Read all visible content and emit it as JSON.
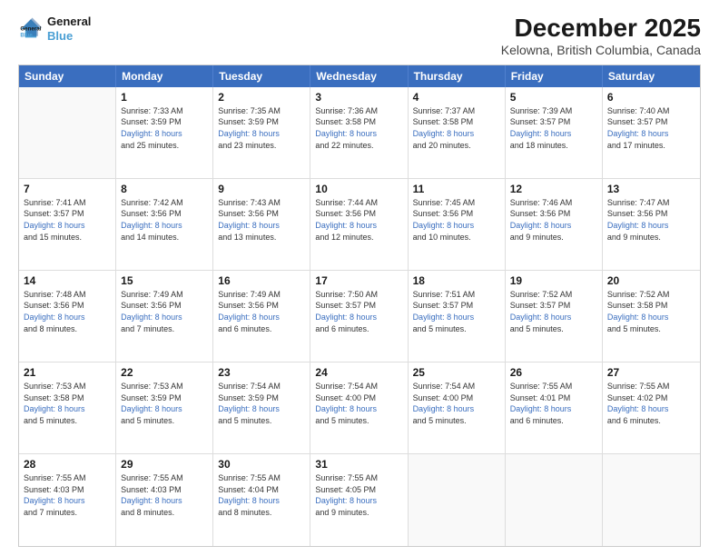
{
  "logo": {
    "line1": "General",
    "line2": "Blue"
  },
  "title": "December 2025",
  "subtitle": "Kelowna, British Columbia, Canada",
  "header_days": [
    "Sunday",
    "Monday",
    "Tuesday",
    "Wednesday",
    "Thursday",
    "Friday",
    "Saturday"
  ],
  "weeks": [
    [
      {
        "day": "",
        "info": []
      },
      {
        "day": "1",
        "info": [
          "Sunrise: 7:33 AM",
          "Sunset: 3:59 PM",
          "Daylight: 8 hours",
          "and 25 minutes."
        ]
      },
      {
        "day": "2",
        "info": [
          "Sunrise: 7:35 AM",
          "Sunset: 3:59 PM",
          "Daylight: 8 hours",
          "and 23 minutes."
        ]
      },
      {
        "day": "3",
        "info": [
          "Sunrise: 7:36 AM",
          "Sunset: 3:58 PM",
          "Daylight: 8 hours",
          "and 22 minutes."
        ]
      },
      {
        "day": "4",
        "info": [
          "Sunrise: 7:37 AM",
          "Sunset: 3:58 PM",
          "Daylight: 8 hours",
          "and 20 minutes."
        ]
      },
      {
        "day": "5",
        "info": [
          "Sunrise: 7:39 AM",
          "Sunset: 3:57 PM",
          "Daylight: 8 hours",
          "and 18 minutes."
        ]
      },
      {
        "day": "6",
        "info": [
          "Sunrise: 7:40 AM",
          "Sunset: 3:57 PM",
          "Daylight: 8 hours",
          "and 17 minutes."
        ]
      }
    ],
    [
      {
        "day": "7",
        "info": [
          "Sunrise: 7:41 AM",
          "Sunset: 3:57 PM",
          "Daylight: 8 hours",
          "and 15 minutes."
        ]
      },
      {
        "day": "8",
        "info": [
          "Sunrise: 7:42 AM",
          "Sunset: 3:56 PM",
          "Daylight: 8 hours",
          "and 14 minutes."
        ]
      },
      {
        "day": "9",
        "info": [
          "Sunrise: 7:43 AM",
          "Sunset: 3:56 PM",
          "Daylight: 8 hours",
          "and 13 minutes."
        ]
      },
      {
        "day": "10",
        "info": [
          "Sunrise: 7:44 AM",
          "Sunset: 3:56 PM",
          "Daylight: 8 hours",
          "and 12 minutes."
        ]
      },
      {
        "day": "11",
        "info": [
          "Sunrise: 7:45 AM",
          "Sunset: 3:56 PM",
          "Daylight: 8 hours",
          "and 10 minutes."
        ]
      },
      {
        "day": "12",
        "info": [
          "Sunrise: 7:46 AM",
          "Sunset: 3:56 PM",
          "Daylight: 8 hours",
          "and 9 minutes."
        ]
      },
      {
        "day": "13",
        "info": [
          "Sunrise: 7:47 AM",
          "Sunset: 3:56 PM",
          "Daylight: 8 hours",
          "and 9 minutes."
        ]
      }
    ],
    [
      {
        "day": "14",
        "info": [
          "Sunrise: 7:48 AM",
          "Sunset: 3:56 PM",
          "Daylight: 8 hours",
          "and 8 minutes."
        ]
      },
      {
        "day": "15",
        "info": [
          "Sunrise: 7:49 AM",
          "Sunset: 3:56 PM",
          "Daylight: 8 hours",
          "and 7 minutes."
        ]
      },
      {
        "day": "16",
        "info": [
          "Sunrise: 7:49 AM",
          "Sunset: 3:56 PM",
          "Daylight: 8 hours",
          "and 6 minutes."
        ]
      },
      {
        "day": "17",
        "info": [
          "Sunrise: 7:50 AM",
          "Sunset: 3:57 PM",
          "Daylight: 8 hours",
          "and 6 minutes."
        ]
      },
      {
        "day": "18",
        "info": [
          "Sunrise: 7:51 AM",
          "Sunset: 3:57 PM",
          "Daylight: 8 hours",
          "and 5 minutes."
        ]
      },
      {
        "day": "19",
        "info": [
          "Sunrise: 7:52 AM",
          "Sunset: 3:57 PM",
          "Daylight: 8 hours",
          "and 5 minutes."
        ]
      },
      {
        "day": "20",
        "info": [
          "Sunrise: 7:52 AM",
          "Sunset: 3:58 PM",
          "Daylight: 8 hours",
          "and 5 minutes."
        ]
      }
    ],
    [
      {
        "day": "21",
        "info": [
          "Sunrise: 7:53 AM",
          "Sunset: 3:58 PM",
          "Daylight: 8 hours",
          "and 5 minutes."
        ]
      },
      {
        "day": "22",
        "info": [
          "Sunrise: 7:53 AM",
          "Sunset: 3:59 PM",
          "Daylight: 8 hours",
          "and 5 minutes."
        ]
      },
      {
        "day": "23",
        "info": [
          "Sunrise: 7:54 AM",
          "Sunset: 3:59 PM",
          "Daylight: 8 hours",
          "and 5 minutes."
        ]
      },
      {
        "day": "24",
        "info": [
          "Sunrise: 7:54 AM",
          "Sunset: 4:00 PM",
          "Daylight: 8 hours",
          "and 5 minutes."
        ]
      },
      {
        "day": "25",
        "info": [
          "Sunrise: 7:54 AM",
          "Sunset: 4:00 PM",
          "Daylight: 8 hours",
          "and 5 minutes."
        ]
      },
      {
        "day": "26",
        "info": [
          "Sunrise: 7:55 AM",
          "Sunset: 4:01 PM",
          "Daylight: 8 hours",
          "and 6 minutes."
        ]
      },
      {
        "day": "27",
        "info": [
          "Sunrise: 7:55 AM",
          "Sunset: 4:02 PM",
          "Daylight: 8 hours",
          "and 6 minutes."
        ]
      }
    ],
    [
      {
        "day": "28",
        "info": [
          "Sunrise: 7:55 AM",
          "Sunset: 4:03 PM",
          "Daylight: 8 hours",
          "and 7 minutes."
        ]
      },
      {
        "day": "29",
        "info": [
          "Sunrise: 7:55 AM",
          "Sunset: 4:03 PM",
          "Daylight: 8 hours",
          "and 8 minutes."
        ]
      },
      {
        "day": "30",
        "info": [
          "Sunrise: 7:55 AM",
          "Sunset: 4:04 PM",
          "Daylight: 8 hours",
          "and 8 minutes."
        ]
      },
      {
        "day": "31",
        "info": [
          "Sunrise: 7:55 AM",
          "Sunset: 4:05 PM",
          "Daylight: 8 hours",
          "and 9 minutes."
        ]
      },
      {
        "day": "",
        "info": []
      },
      {
        "day": "",
        "info": []
      },
      {
        "day": "",
        "info": []
      }
    ]
  ]
}
